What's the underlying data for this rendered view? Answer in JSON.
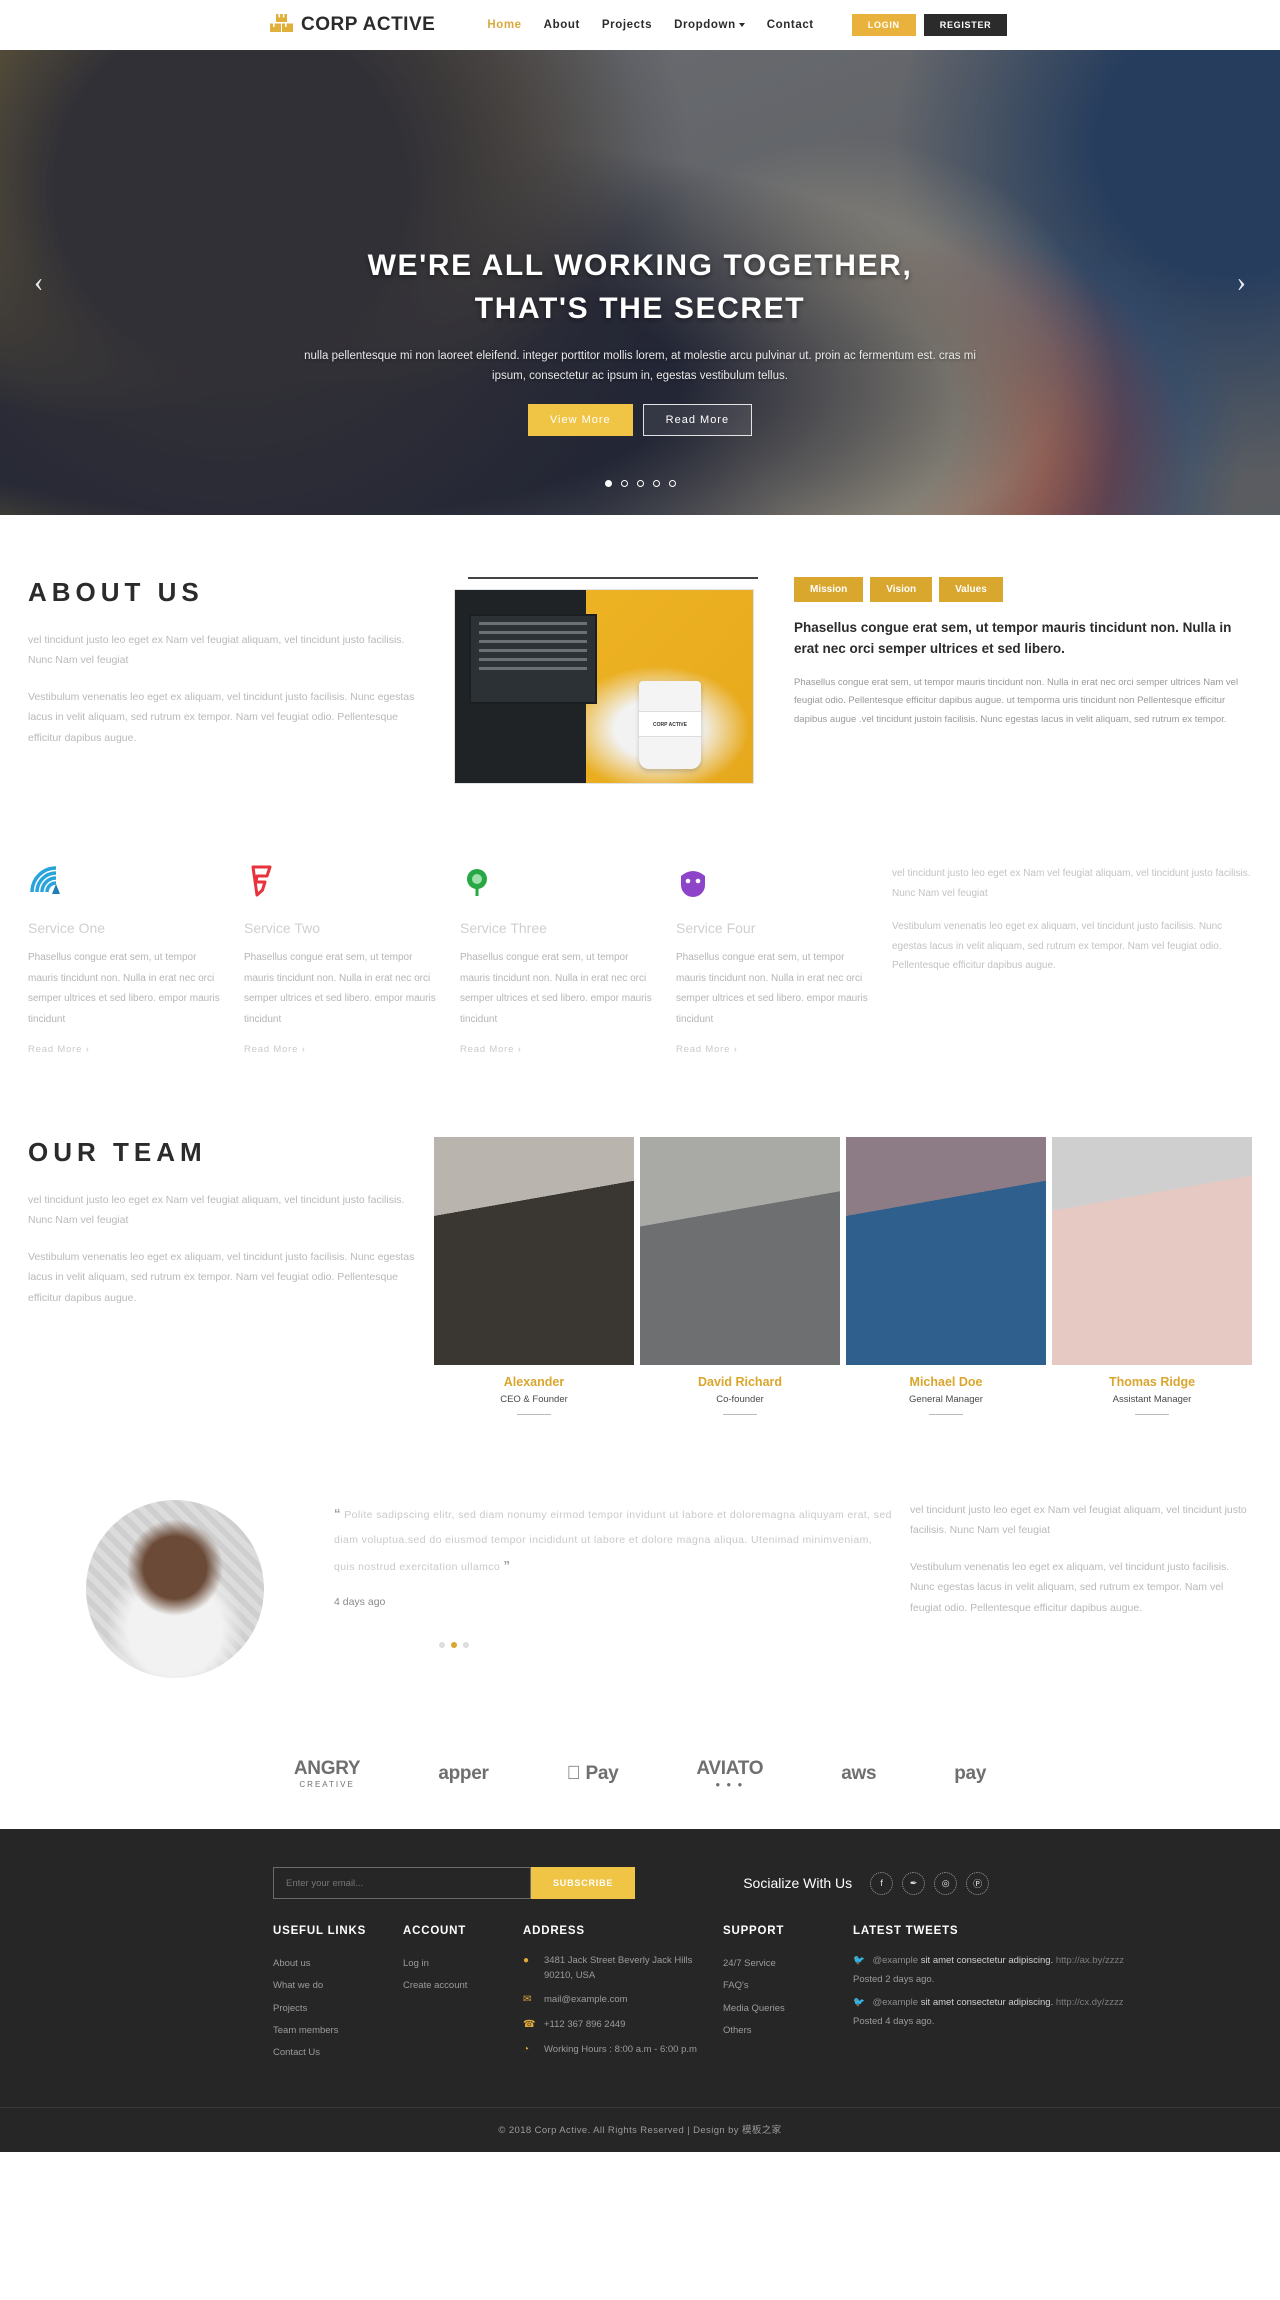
{
  "header": {
    "brand": "CORP ACTIVE",
    "brand_icon": "boxes-icon",
    "nav": [
      {
        "label": "Home",
        "active": true
      },
      {
        "label": "About",
        "active": false
      },
      {
        "label": "Projects",
        "active": false
      },
      {
        "label": "Dropdown",
        "active": false,
        "dropdown": true
      },
      {
        "label": "Contact",
        "active": false
      }
    ],
    "login_label": "LOGIN",
    "register_label": "REGISTER",
    "accent": "#d9a93c"
  },
  "hero": {
    "title_line1": "WE'RE ALL WORKING TOGETHER,",
    "title_line2": "THAT'S THE SECRET",
    "subtitle": "nulla pellentesque mi non laoreet eleifend. integer porttitor mollis lorem, at molestie arcu pulvinar ut. proin ac fermentum est. cras mi ipsum, consectetur ac ipsum in, egestas vestibulum tellus.",
    "btn_primary": "View More",
    "btn_secondary": "Read More",
    "prev_icon": "chevron-left-icon",
    "next_icon": "chevron-right-icon",
    "slides": 5,
    "active_slide": 1
  },
  "about": {
    "title": "ABOUT US",
    "p1": "vel tincidunt justo leo eget ex Nam vel feugiat aliquam, vel tincidunt justo facilisis. Nunc Nam vel feugiat",
    "p2": "Vestibulum venenatis leo eget ex aliquam, vel tincidunt justo facilisis. Nunc egestas lacus in velit aliquam, sed rutrum ex tempor. Nam vel feugiat odio. Pellentesque efficitur dapibus augue.",
    "cup_text": "CORP ACTIVE",
    "tabs": [
      "Mission",
      "Vision",
      "Values"
    ],
    "lead": "Phasellus congue erat sem, ut tempor mauris tincidunt non. Nulla in erat nec orci semper ultrices et sed libero.",
    "body": "Phasellus congue erat sem, ut tempor mauris tincidunt non. Nulla in erat nec orci semper ultrices Nam vel feugiat odio. Pellentesque efficitur dapibus augue. ut temporma uris tincidunt non Pellentesque efficitur dapibus augue .vel tincidunt justoin facilisis. Nunc egestas lacus in velit aliquam, sed rutrum ex tempor."
  },
  "services": {
    "read_more": "Read More ›",
    "items": [
      {
        "icon": "signal-wave-icon",
        "color": "#29a3dc",
        "title": "Service One",
        "text": "Phasellus congue erat sem, ut tempor mauris tincidunt non. Nulla in erat nec orci semper ultrices et sed libero. empor mauris tincidunt"
      },
      {
        "icon": "foursquare-flag-icon",
        "color": "#e8323c",
        "title": "Service Two",
        "text": "Phasellus congue erat sem, ut tempor mauris tincidunt non. Nulla in erat nec orci semper ultrices et sed libero. empor mauris tincidunt"
      },
      {
        "icon": "green-globe-icon",
        "color": "#27a844",
        "title": "Service Three",
        "text": "Phasellus congue erat sem, ut tempor mauris tincidunt non. Nulla in erat nec orci semper ultrices et sed libero. empor mauris tincidunt"
      },
      {
        "icon": "purple-circle-icon",
        "color": "#8e44c9",
        "title": "Service Four",
        "text": "Phasellus congue erat sem, ut tempor mauris tincidunt non. Nulla in erat nec orci semper ultrices et sed libero. empor mauris tincidunt"
      }
    ],
    "side_p1": "vel tincidunt justo leo eget ex Nam vel feugiat aliquam, vel tincidunt justo facilisis. Nunc Nam vel feugiat",
    "side_p2": "Vestibulum venenatis leo eget ex aliquam, vel tincidunt justo facilisis. Nunc egestas lacus in velit aliquam, sed rutrum ex tempor. Nam vel feugiat odio. Pellentesque efficitur dapibus augue."
  },
  "team": {
    "title": "OUR TEAM",
    "p1": "vel tincidunt justo leo eget ex Nam vel feugiat aliquam, vel tincidunt justo facilisis. Nunc Nam vel feugiat",
    "p2": "Vestibulum venenatis leo eget ex aliquam, vel tincidunt justo facilisis. Nunc egestas lacus in velit aliquam, sed rutrum ex tempor. Nam vel feugiat odio. Pellentesque efficitur dapibus augue.",
    "members": [
      {
        "name": "Alexander",
        "role": "CEO & Founder"
      },
      {
        "name": "David Richard",
        "role": "Co-founder"
      },
      {
        "name": "Michael Doe",
        "role": "General Manager"
      },
      {
        "name": "Thomas Ridge",
        "role": "Assistant Manager"
      }
    ]
  },
  "testimonial": {
    "quote_open": "“",
    "quote_close": "”",
    "quote": "Polite sadipscing elitr, sed diam nonumy eirmod tempor invidunt ut labore et doloremagna aliquyam erat, sed diam voluptua.sed do eiusmod tempor incididunt ut labore et dolore magna aliqua. Utenimad minimveniam, quis nostrud exercitation ullamco",
    "date": "4 days ago",
    "dots": 3,
    "active_dot": 1,
    "side_p1": "vel tincidunt justo leo eget ex Nam vel feugiat aliquam, vel tincidunt justo facilisis. Nunc Nam vel feugiat",
    "side_p2": "Vestibulum venenatis leo eget ex aliquam, vel tincidunt justo facilisis. Nunc egestas lacus in velit aliquam, sed rutrum ex tempor. Nam vel feugiat odio. Pellentesque efficitur dapibus augue."
  },
  "brand_logos": [
    {
      "name": "ANGRY",
      "sub": "CREATIVE"
    },
    {
      "name": "apper",
      "sub": ""
    },
    {
      "name": " Pay",
      "sub": ""
    },
    {
      "name": "AVIATO",
      "sub": "● ● ●"
    },
    {
      "name": "aws",
      "sub": ""
    },
    {
      "name": "pay",
      "sub": ""
    }
  ],
  "footer": {
    "email_placeholder": "Enter your email...",
    "subscribe_label": "SUBSCRIBE",
    "social_label": "Socialize With Us",
    "social_icons": [
      "facebook-icon",
      "twitter-icon",
      "instagram-icon",
      "pinterest-icon"
    ],
    "social_glyphs": [
      "f",
      "✒",
      "◎",
      "Ⓟ"
    ],
    "cols": {
      "useful_links": {
        "heading": "USEFUL LINKS",
        "items": [
          "About us",
          "What we do",
          "Projects",
          "Team members",
          "Contact Us"
        ]
      },
      "account": {
        "heading": "ACCOUNT",
        "items": [
          "Log in",
          "Create account"
        ]
      },
      "address": {
        "heading": "ADDRESS",
        "rows": [
          {
            "icon": "map-pin-icon",
            "glyph": "●",
            "text": "3481 Jack Street Beverly Jack Hills 90210, USA"
          },
          {
            "icon": "envelope-icon",
            "glyph": "✉",
            "text": "mail@example.com"
          },
          {
            "icon": "phone-icon",
            "glyph": "☎",
            "text": "+112 367 896 2449"
          },
          {
            "icon": "clock-icon",
            "glyph": "◔",
            "text": "Working Hours : 8:00 a.m - 6:00 p.m"
          }
        ]
      },
      "support": {
        "heading": "SUPPORT",
        "items": [
          "24/7 Service",
          "FAQ's",
          "Media Queries",
          "Others"
        ]
      },
      "tweets": {
        "heading": "LATEST TWEETS",
        "items": [
          {
            "handle": "@example",
            "text": "sit amet consectetur adipiscing.",
            "link": "http://ax.by/zzzz",
            "posted": "Posted 2 days ago."
          },
          {
            "handle": "@example",
            "text": "sit amet consectetur adipiscing.",
            "link": "http://cx.dy/zzzz",
            "posted": "Posted 4 days ago."
          }
        ]
      }
    },
    "copyright": "© 2018 Corp Active. All Rights Reserved | Design by 模板之家"
  }
}
